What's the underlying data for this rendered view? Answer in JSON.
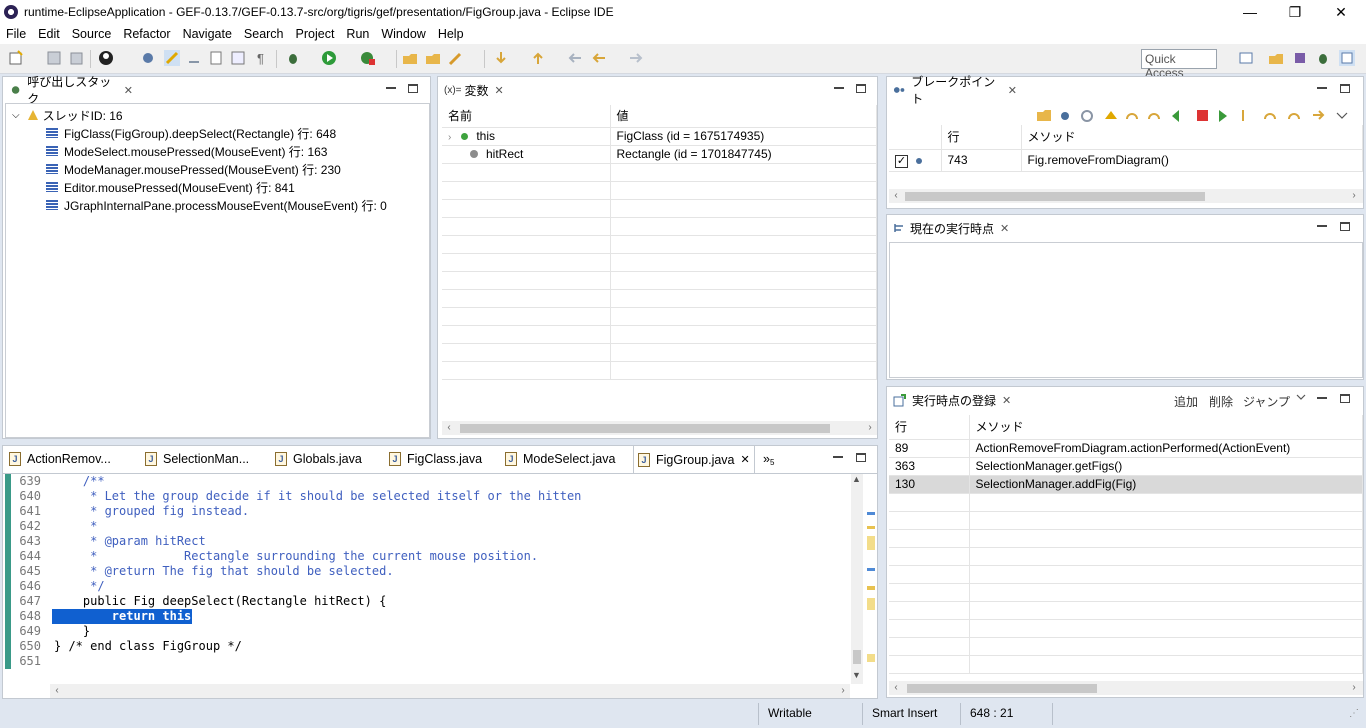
{
  "window": {
    "title": "runtime-EclipseApplication - GEF-0.13.7/GEF-0.13.7-src/org/tigris/gef/presentation/FigGroup.java - Eclipse IDE",
    "minimize": "—",
    "restore": "❐",
    "close": "✕"
  },
  "menu": [
    "File",
    "Edit",
    "Source",
    "Refactor",
    "Navigate",
    "Search",
    "Project",
    "Run",
    "Window",
    "Help"
  ],
  "toolbar": {
    "quick_access": "Quick Access"
  },
  "callstack": {
    "tab_label": "呼び出しスタック",
    "thread": "スレッドID: 16",
    "frames": [
      "FigClass(FigGroup).deepSelect(Rectangle) 行: 648",
      "ModeSelect.mousePressed(MouseEvent) 行: 163",
      "ModeManager.mousePressed(MouseEvent) 行: 230",
      "Editor.mousePressed(MouseEvent) 行: 841",
      "JGraphInternalPane.processMouseEvent(MouseEvent) 行: 0"
    ]
  },
  "variables": {
    "tab_prefix": "(x)=",
    "tab_label": "変数",
    "col_name": "名前",
    "col_value": "値",
    "rows": [
      {
        "name": "this",
        "value": "FigClass  (id = 1675174935)",
        "expandable": true
      },
      {
        "name": "hitRect",
        "value": "Rectangle  (id = 1701847745)",
        "expandable": false
      }
    ]
  },
  "breakpoints": {
    "tab_label": "ブレークポイント",
    "col_line": "行",
    "col_method": "メソッド",
    "rows": [
      {
        "checked": true,
        "line": "743",
        "method": "Fig.removeFromDiagram()"
      }
    ]
  },
  "current_point": {
    "tab_label": "現在の実行時点"
  },
  "registrations": {
    "tab_label": "実行時点の登録",
    "add": "追加",
    "delete": "削除",
    "jump": "ジャンプ",
    "col_line": "行",
    "col_method": "メソッド",
    "rows": [
      {
        "line": "89",
        "method": "ActionRemoveFromDiagram.actionPerformed(ActionEvent)"
      },
      {
        "line": "363",
        "method": "SelectionManager.getFigs()"
      },
      {
        "line": "130",
        "method": "SelectionManager.addFig(Fig)",
        "selected": true
      }
    ]
  },
  "editor": {
    "tabs": [
      "ActionRemov...",
      "SelectionMan...",
      "Globals.java",
      "FigClass.java",
      "ModeSelect.java",
      "FigGroup.java"
    ],
    "active_tab": 5,
    "overflow": "»",
    "overflow_count": "5",
    "lines": [
      {
        "n": "639",
        "text": "    /**",
        "fold": true
      },
      {
        "n": "640",
        "text": "     * Let the group decide if it should be selected itself or the hitten"
      },
      {
        "n": "641",
        "text": "     * grouped fig instead."
      },
      {
        "n": "642",
        "text": "     *"
      },
      {
        "n": "643",
        "text": "     * @param hitRect"
      },
      {
        "n": "644",
        "text": "     *            Rectangle surrounding the current mouse position."
      },
      {
        "n": "645",
        "text": "     * @return The fig that should be selected."
      },
      {
        "n": "646",
        "text": "     */"
      },
      {
        "n": "647",
        "text": "    public Fig deepSelect(Rectangle hitRect) {",
        "fold": true
      },
      {
        "n": "648",
        "text": "        return this;",
        "highlight": true
      },
      {
        "n": "649",
        "text": "    }"
      },
      {
        "n": "650",
        "text": "} /* end class FigGroup */"
      },
      {
        "n": "651",
        "text": ""
      }
    ]
  },
  "status": {
    "writable": "Writable",
    "insert_mode": "Smart Insert",
    "position": "648 : 21"
  }
}
